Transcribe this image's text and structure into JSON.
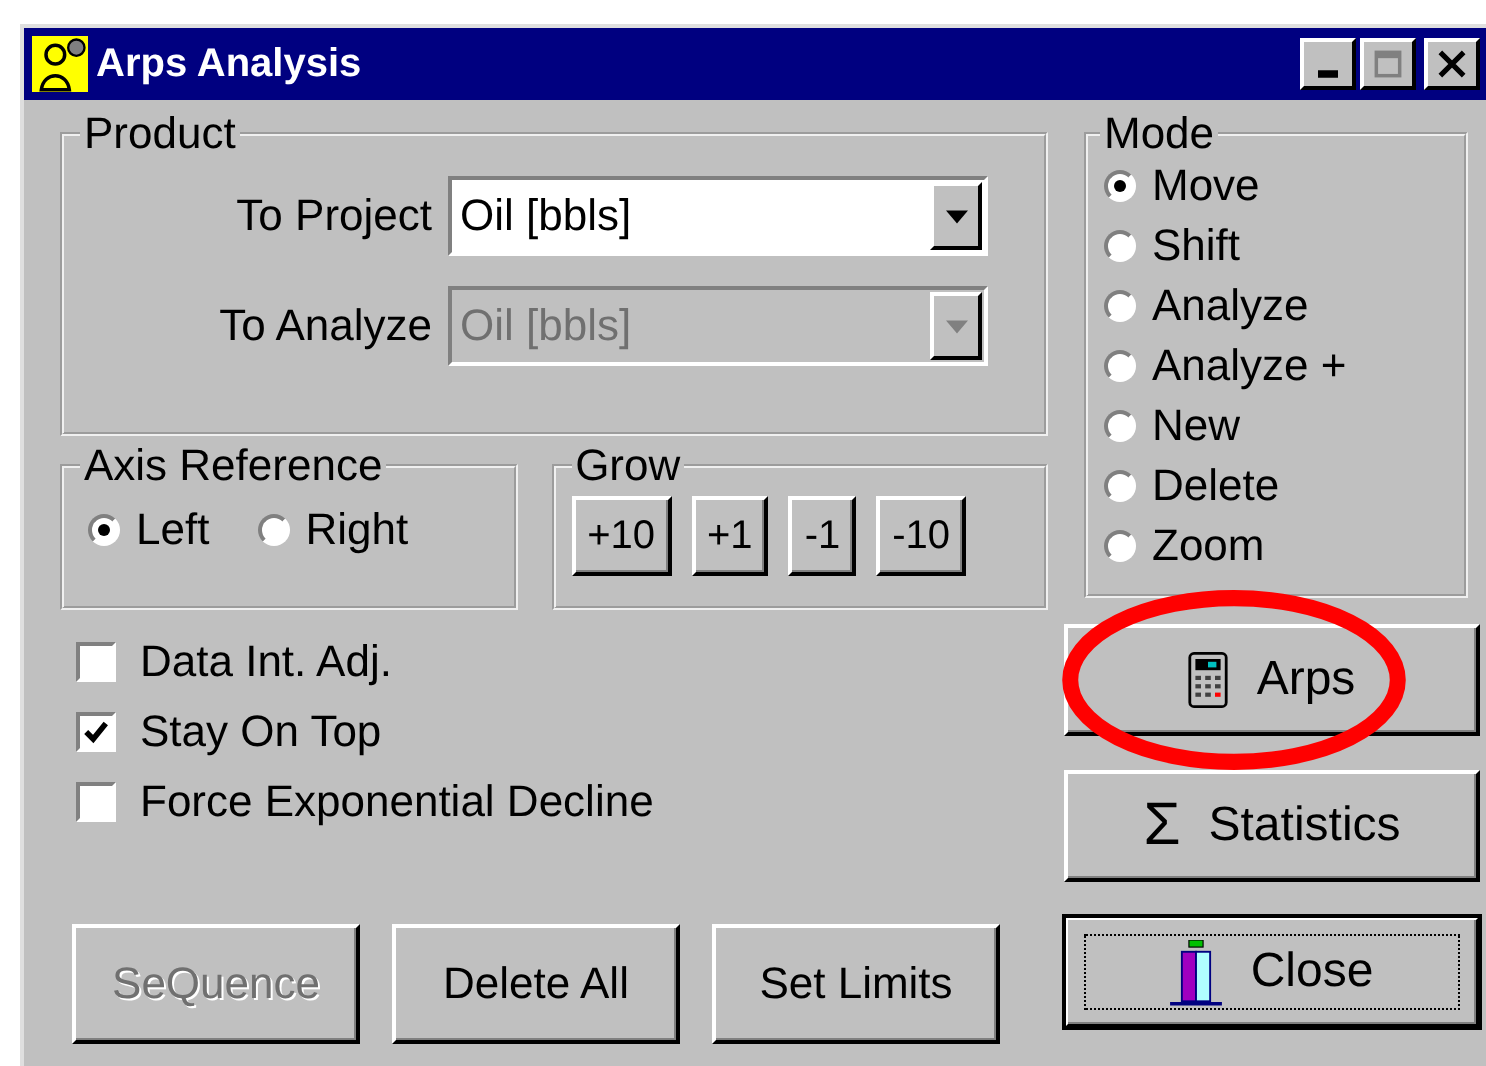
{
  "window": {
    "title": "Arps Analysis"
  },
  "product": {
    "label": "Product",
    "fields": [
      {
        "label": "To Project",
        "value": "Oil [bbls]",
        "disabled": false
      },
      {
        "label": "To Analyze",
        "value": "Oil [bbls]",
        "disabled": true
      }
    ]
  },
  "axis_reference": {
    "label": "Axis Reference",
    "options": [
      {
        "label": "Left",
        "selected": true
      },
      {
        "label": "Right",
        "selected": false
      }
    ]
  },
  "grow": {
    "label": "Grow",
    "buttons": [
      "+10",
      "+1",
      "-1",
      "-10"
    ]
  },
  "options": [
    {
      "label": "Data Int. Adj.",
      "checked": false
    },
    {
      "label": "Stay On Top",
      "checked": true
    },
    {
      "label": "Force Exponential Decline",
      "checked": false
    }
  ],
  "bottom_buttons": [
    {
      "label": "SeQuence",
      "disabled": true
    },
    {
      "label": "Delete All",
      "disabled": false
    },
    {
      "label": "Set Limits",
      "disabled": false
    }
  ],
  "mode": {
    "label": "Mode",
    "options": [
      {
        "label": "Move",
        "selected": true
      },
      {
        "label": "Shift",
        "selected": false
      },
      {
        "label": "Analyze",
        "selected": false
      },
      {
        "label": "Analyze +",
        "selected": false
      },
      {
        "label": "New",
        "selected": false
      },
      {
        "label": "Delete",
        "selected": false
      },
      {
        "label": "Zoom",
        "selected": false
      }
    ]
  },
  "side_buttons": [
    {
      "label": "Arps",
      "kind": "calculator",
      "circled": true,
      "default": false
    },
    {
      "label": "Statistics",
      "kind": "sigma",
      "symbol": "Σ",
      "circled": false,
      "default": false
    },
    {
      "label": "Close",
      "kind": "chart",
      "circled": false,
      "default": true
    }
  ]
}
